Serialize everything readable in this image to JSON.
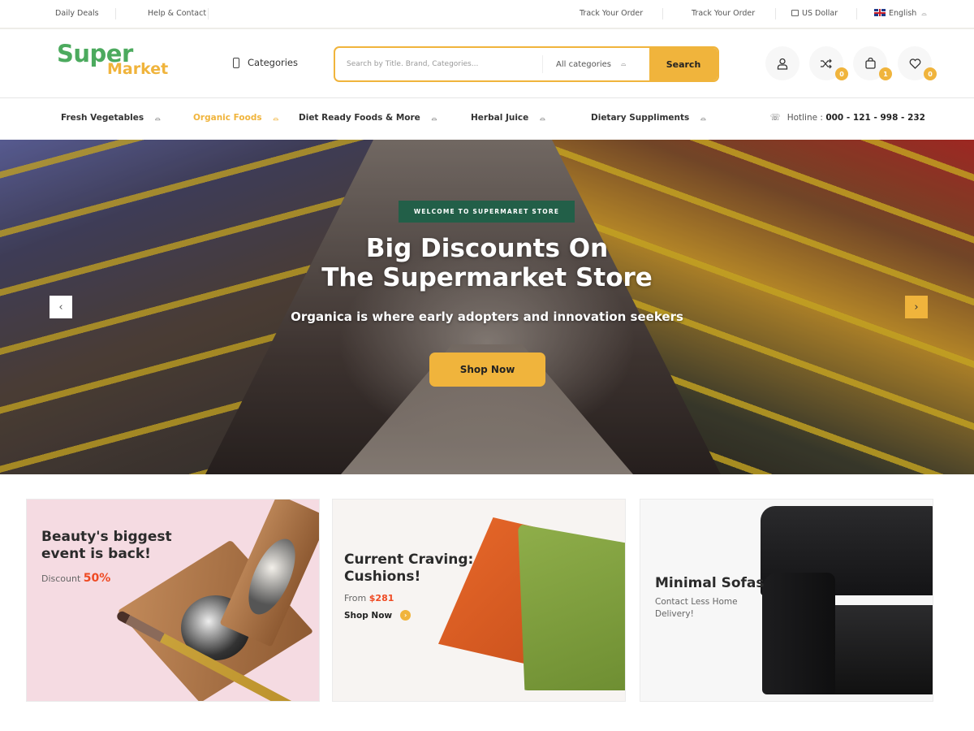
{
  "topbar": {
    "left_links": [
      "Daily Deals",
      "Help & Contact"
    ],
    "right_links": [
      "Track Your Order",
      "Track Your Order"
    ],
    "currency": "US Dollar",
    "language": "English"
  },
  "header": {
    "logo": {
      "line1": "Super",
      "line2": "Market"
    },
    "categories_label": "Categories",
    "search": {
      "placeholder": "Search by Title. Brand, Categories...",
      "value": "",
      "category_select": "All categories",
      "button_label": "Search"
    },
    "icons": [
      {
        "name": "user-icon",
        "badge": null
      },
      {
        "name": "compare-icon",
        "badge": "0"
      },
      {
        "name": "cart-icon",
        "badge": "1"
      },
      {
        "name": "wishlist-icon",
        "badge": "0"
      }
    ]
  },
  "nav": {
    "items": [
      {
        "label": "Fresh Vegetables",
        "active": false
      },
      {
        "label": "Organic Foods",
        "active": true
      },
      {
        "label": "Diet Ready Foods & More",
        "active": false
      },
      {
        "label": "Herbal Juice",
        "active": false
      },
      {
        "label": "Dietary Suppliments",
        "active": false
      }
    ],
    "hotline_label": "Hotline :",
    "hotline_number": "000 - 121 - 998 - 232"
  },
  "hero": {
    "badge": "WELCOME TO SUPERMARET STORE",
    "title_line1": "Big Discounts On",
    "title_line2": "The Supermarket Store",
    "subtitle": "Organica is where early adopters and innovation seekers",
    "button_label": "Shop Now",
    "prev_arrow": "‹",
    "next_arrow": "›"
  },
  "banners": [
    {
      "title_line1": "Beauty's biggest",
      "title_line2": "event is back!",
      "text_prefix": "Discount",
      "highlight": "50%"
    },
    {
      "title_line1": "Current Craving:",
      "title_line2": "Cushions!",
      "text_prefix": "From",
      "highlight": "$281",
      "link_label": "Shop Now"
    },
    {
      "title_line1": "Minimal Sofas",
      "text_line1": "Contact Less Home",
      "text_line2": "Delivery!"
    }
  ],
  "colors": {
    "brand_green": "#4caa5e",
    "brand_yellow": "#f0b43c",
    "badge_green": "#225f48",
    "highlight_red": "#ef4a23"
  }
}
